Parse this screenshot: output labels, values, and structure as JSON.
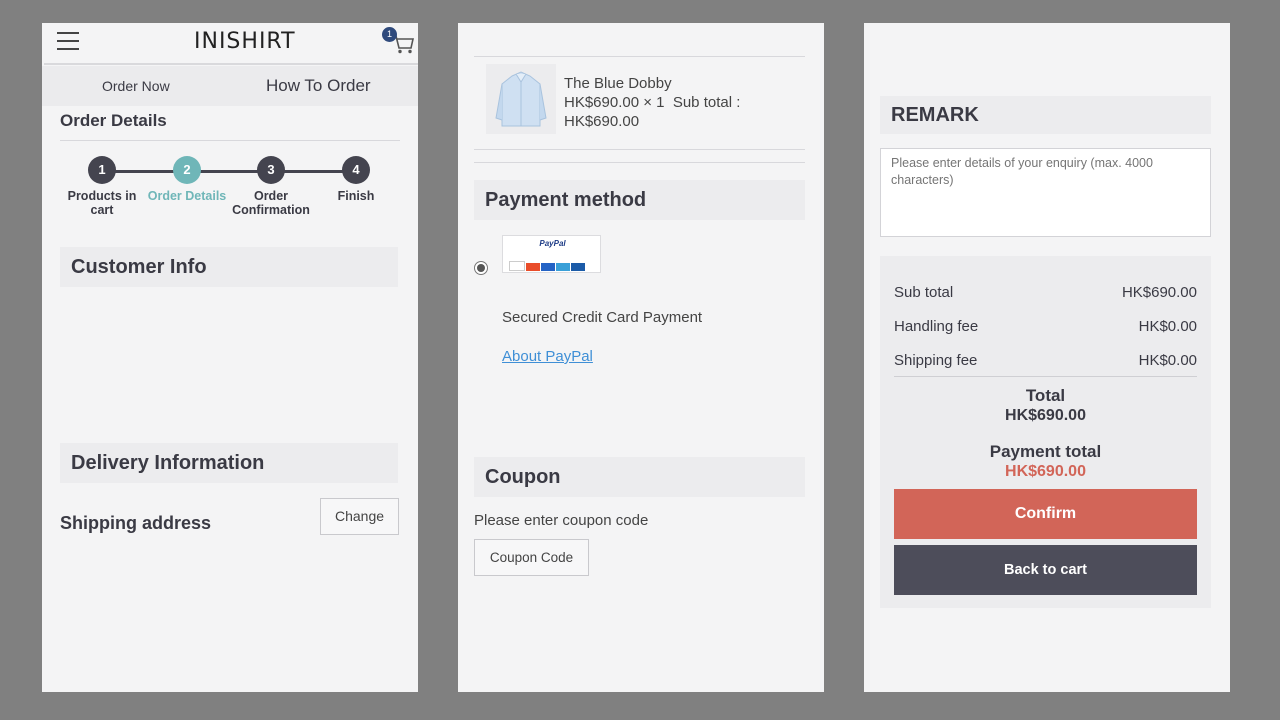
{
  "header": {
    "logo": "INISHIRT",
    "cart_count": "1"
  },
  "subnav": {
    "order_now": "Order Now",
    "how_to_order": "How To Order"
  },
  "order_details_title": "Order Details",
  "steps": [
    {
      "num": "1",
      "label_line1": "Products in",
      "label_line2": "cart"
    },
    {
      "num": "2",
      "label_line1": "Order Details",
      "label_line2": ""
    },
    {
      "num": "3",
      "label_line1": "Order",
      "label_line2": "Confirmation"
    },
    {
      "num": "4",
      "label_line1": "Finish",
      "label_line2": ""
    }
  ],
  "customer_info_title": "Customer Info",
  "delivery_title": "Delivery Information",
  "shipping_address_label": "Shipping address",
  "change_button": "Change",
  "product": {
    "name": "The Blue Dobby",
    "price_line": "HK$690.00 × 1  Sub total :",
    "subtotal": "HK$690.00"
  },
  "payment": {
    "title": "Payment method",
    "paypal_logo": "PayPal",
    "secured_text": "Secured Credit Card Payment",
    "about_link": "About PayPal"
  },
  "coupon": {
    "title": "Coupon",
    "prompt": "Please enter coupon code",
    "button": "Coupon Code"
  },
  "remark": {
    "title": "REMARK",
    "placeholder": "Please enter details of your enquiry (max. 4000 characters)"
  },
  "summary": {
    "sub_total_label": "Sub total",
    "sub_total_value": "HK$690.00",
    "handling_label": "Handling fee",
    "handling_value": "HK$0.00",
    "shipping_label": "Shipping fee",
    "shipping_value": "HK$0.00",
    "total_label": "Total",
    "total_value": "HK$690.00",
    "payment_total_label": "Payment total",
    "payment_total_value": "HK$690.00"
  },
  "buttons": {
    "confirm": "Confirm",
    "back_to_cart": "Back to cart"
  },
  "colors": {
    "accent_teal": "#6fb6b8",
    "confirm_red": "#d26558",
    "dark_button": "#4d4d5a",
    "payment_total_red": "#d26558"
  }
}
